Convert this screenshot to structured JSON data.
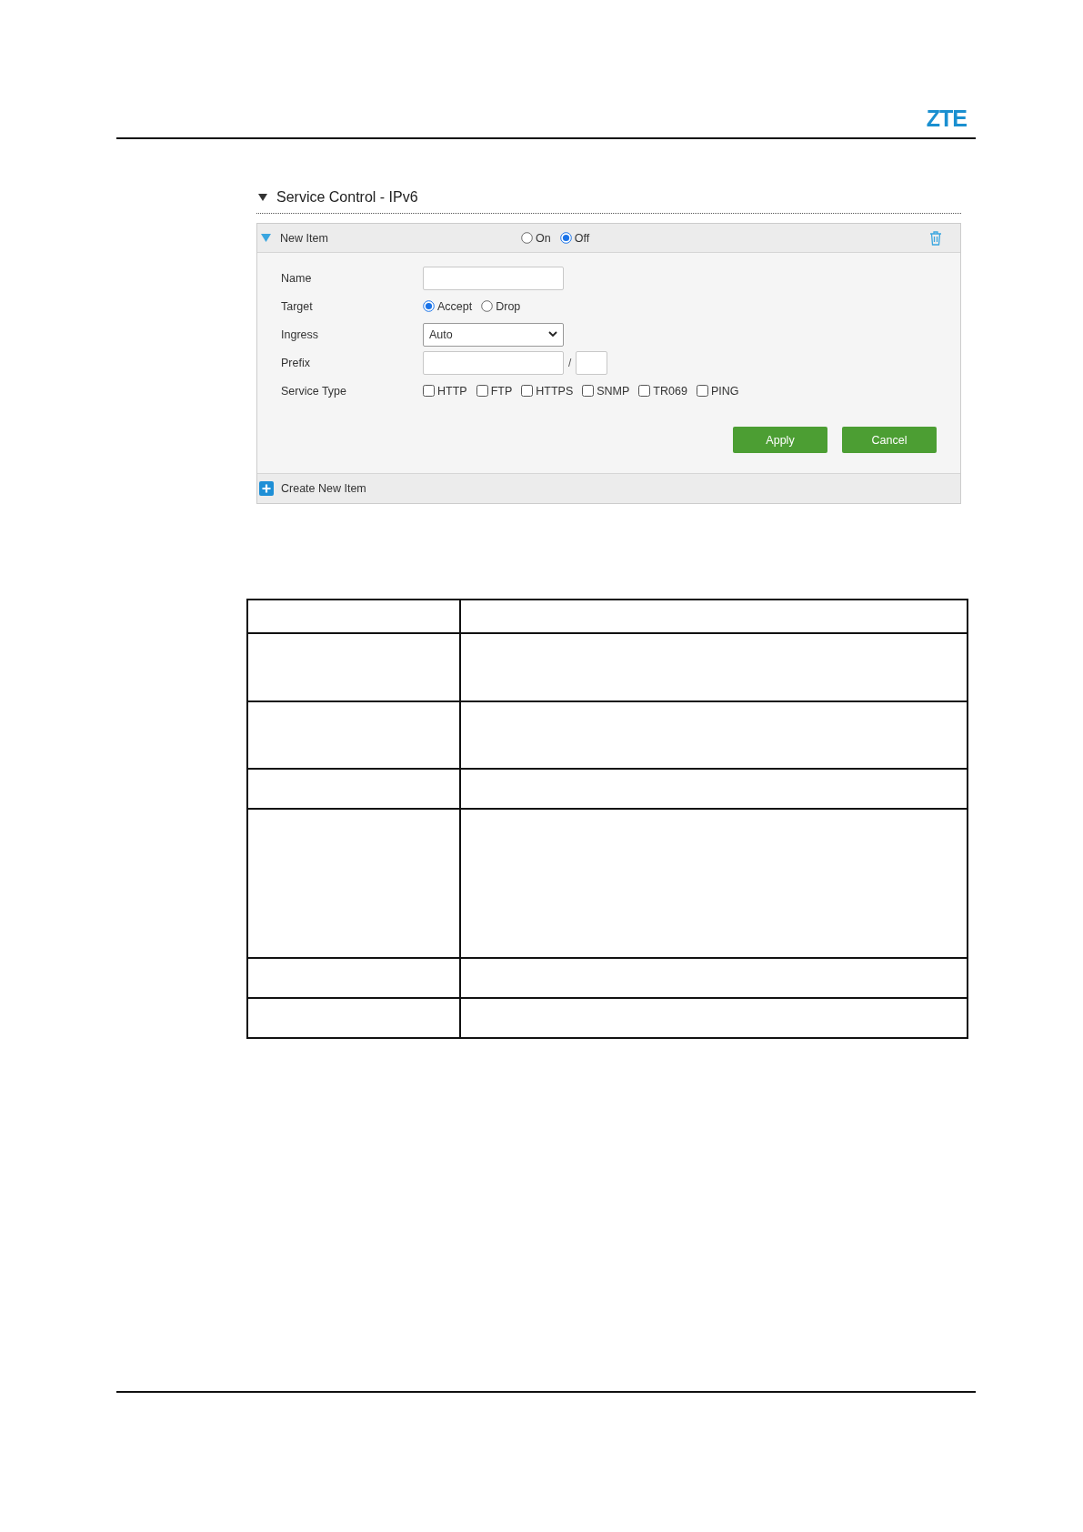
{
  "logo": "ZTE",
  "section": {
    "title": "Service Control - IPv6",
    "expanded": true
  },
  "item": {
    "title": "New Item",
    "expanded": true,
    "status": [
      {
        "label": "On",
        "selected": false
      },
      {
        "label": "Off",
        "selected": true
      }
    ],
    "fields": [
      {
        "kind": "text",
        "label": "Name"
      },
      {
        "kind": "radio",
        "label": "Target",
        "options": [
          {
            "label": "Accept",
            "selected": true
          },
          {
            "label": "Drop",
            "selected": false
          }
        ]
      },
      {
        "kind": "select",
        "label": "Ingress",
        "value": "Auto"
      },
      {
        "kind": "prefix",
        "label": "Prefix",
        "separator": "/"
      },
      {
        "kind": "checkboxes",
        "label": "Service Type",
        "options": [
          {
            "label": "HTTP",
            "checked": false
          },
          {
            "label": "FTP",
            "checked": false
          },
          {
            "label": "HTTPS",
            "checked": false
          },
          {
            "label": "SNMP",
            "checked": false
          },
          {
            "label": "TR069",
            "checked": false
          },
          {
            "label": "PING",
            "checked": false
          }
        ]
      }
    ],
    "buttons": [
      "Apply",
      "Cancel"
    ]
  },
  "create": {
    "label": "Create New Item"
  }
}
